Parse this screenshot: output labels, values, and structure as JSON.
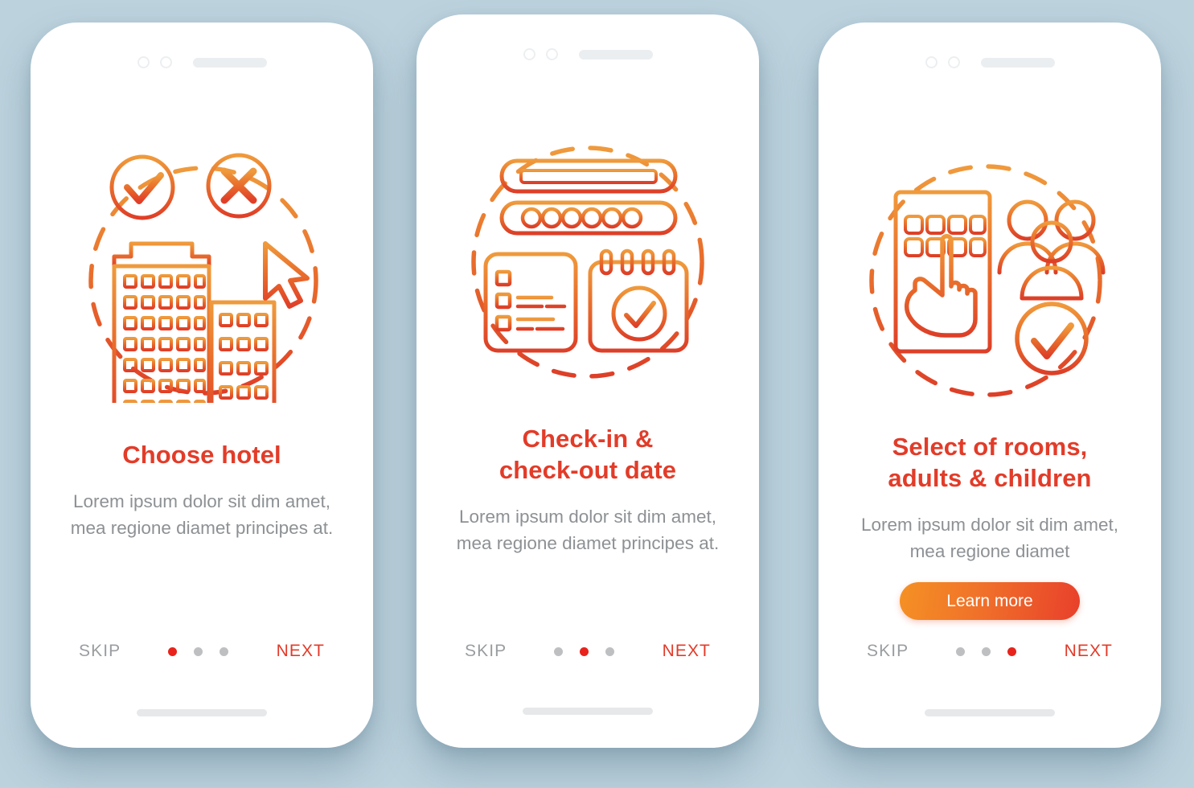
{
  "meta": {
    "background_color": "#bcd2dd",
    "accent_red": "#e23c29",
    "accent_orange": "#f59124",
    "muted_text": "#8d9194"
  },
  "screens": [
    {
      "id": "choose-hotel",
      "illustration": "hotel-buildings-select",
      "title": "Choose hotel",
      "description": "Lorem ipsum dolor sit dim amet, mea regione diamet principes at.",
      "cta": null,
      "nav": {
        "skip_label": "SKIP",
        "next_label": "NEXT",
        "dots": 3,
        "active_dot": 0
      }
    },
    {
      "id": "check-in-out-date",
      "illustration": "calendar-checklist-search",
      "title": "Check-in &\ncheck-out date",
      "description": "Lorem ipsum dolor sit dim amet, mea regione diamet principes at.",
      "cta": null,
      "nav": {
        "skip_label": "SKIP",
        "next_label": "NEXT",
        "dots": 3,
        "active_dot": 1
      }
    },
    {
      "id": "select-rooms-adults-children",
      "illustration": "phone-tap-people-check",
      "title": "Select of rooms,\nadults & children",
      "description": "Lorem ipsum dolor sit dim amet, mea regione diamet",
      "cta": "Learn more",
      "nav": {
        "skip_label": "SKIP",
        "next_label": "NEXT",
        "dots": 3,
        "active_dot": 2
      }
    }
  ]
}
